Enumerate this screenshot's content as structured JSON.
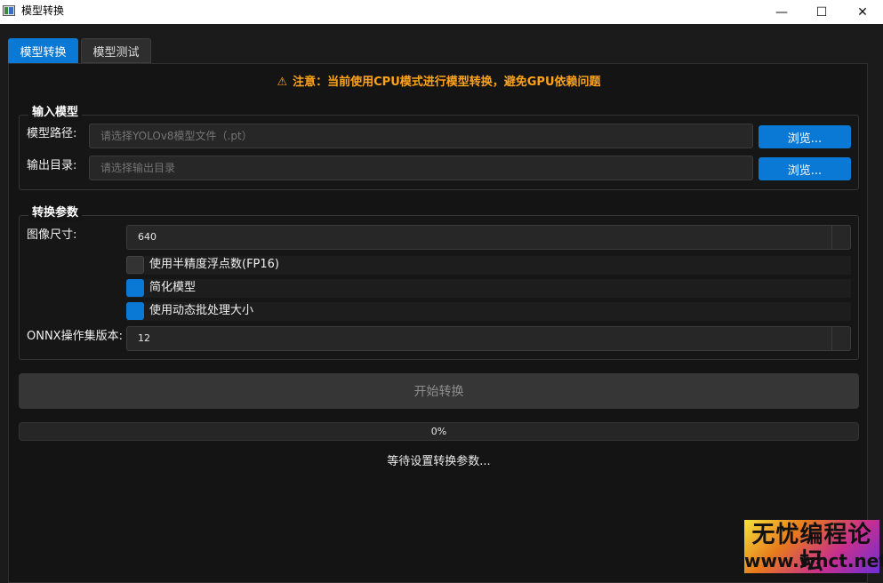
{
  "window": {
    "title": "模型转换",
    "minimize": "—",
    "maximize": "☐",
    "close": "✕"
  },
  "tabs": [
    {
      "label": "模型转换",
      "active": true
    },
    {
      "label": "模型测试",
      "active": false
    }
  ],
  "warning": {
    "icon": "warning-icon",
    "text": "注意：当前使用CPU模式进行模型转换，避免GPU依赖问题"
  },
  "input_group": {
    "title": "输入模型",
    "model_path_label": "模型路径:",
    "model_path_placeholder": "请选择YOLOv8模型文件（.pt）",
    "output_dir_label": "输出目录:",
    "output_dir_placeholder": "请选择输出目录",
    "browse_label": "浏览..."
  },
  "params_group": {
    "title": "转换参数",
    "image_size_label": "图像尺寸:",
    "image_size_value": "640",
    "fp16_label": "使用半精度浮点数(FP16)",
    "fp16_checked": false,
    "simplify_label": "简化模型",
    "simplify_checked": true,
    "dynamic_label": "使用动态批处理大小",
    "dynamic_checked": true,
    "opset_label": "ONNX操作集版本:",
    "opset_value": "12"
  },
  "start_button": "开始转换",
  "progress": {
    "value": 0,
    "text": "0%"
  },
  "status": "等待设置转换参数...",
  "watermark": {
    "line1": "无忧编程论坛",
    "line2": "www.whct.net"
  },
  "colors": {
    "accent": "#0a78d5",
    "warning": "#ffa31a",
    "background": "#141414"
  }
}
